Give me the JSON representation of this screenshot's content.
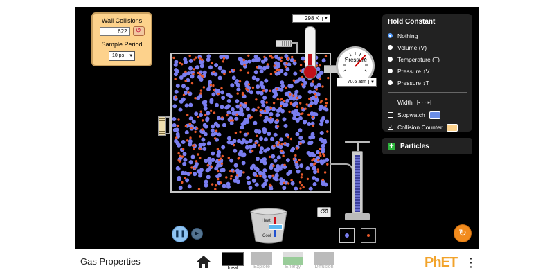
{
  "wall_collisions": {
    "title": "Wall Collisions",
    "count": "622",
    "sample_period_label": "Sample Period",
    "sample_period_value": "10 ps"
  },
  "temperature": {
    "value": "298 K"
  },
  "pressure": {
    "label": "Pressure",
    "value": "70.6 atm"
  },
  "hold_constant": {
    "title": "Hold Constant",
    "options": [
      "Nothing",
      "Volume (V)",
      "Temperature (T)",
      "Pressure ↕V",
      "Pressure ↕T"
    ],
    "selected": "Nothing"
  },
  "checkboxes": {
    "width": {
      "label": "Width",
      "checked": false
    },
    "stopwatch": {
      "label": "Stopwatch",
      "checked": false
    },
    "collision_counter": {
      "label": "Collision Counter",
      "checked": true
    }
  },
  "particles_panel": {
    "label": "Particles"
  },
  "heat_cool": {
    "heat_label": "Heat",
    "cool_label": "Cool"
  },
  "nav": {
    "app_title": "Gas Properties",
    "screens": [
      {
        "label": "Ideal",
        "active": true
      },
      {
        "label": "Explore",
        "active": false
      },
      {
        "label": "Energy",
        "active": false
      },
      {
        "label": "Diffusion",
        "active": false
      }
    ],
    "brand": "PhET"
  },
  "colors": {
    "heavy_particle": "#7a7ef0",
    "light_particle": "#e8592a",
    "panel_bg": "#222222",
    "collision_panel": "#fdd28c",
    "reset_all": "#f28b1d",
    "sim_bg": "#000000"
  },
  "icons": {
    "reset_count": "undo-icon",
    "play_pause": "pause-icon",
    "step": "step-forward-icon",
    "reset_all": "reset-all-icon",
    "home": "home-icon",
    "menu": "kebab-menu-icon",
    "eraser": "eraser-icon"
  }
}
